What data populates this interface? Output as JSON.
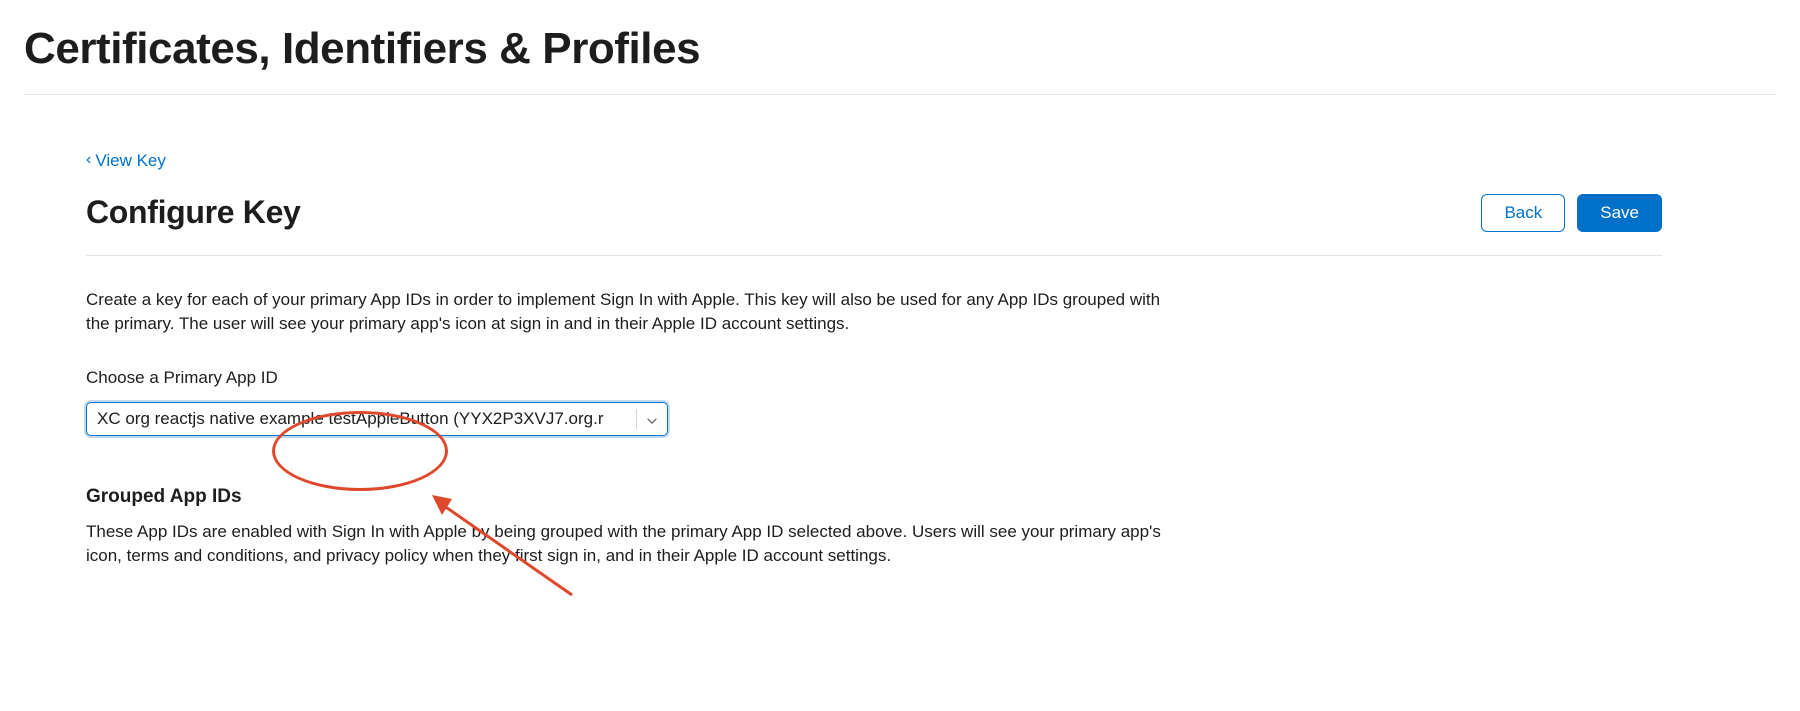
{
  "header": {
    "title": "Certificates, Identifiers & Profiles"
  },
  "nav": {
    "back_label": "View Key"
  },
  "section": {
    "title": "Configure Key",
    "back_button": "Back",
    "save_button": "Save"
  },
  "intro": "Create a key for each of your primary App IDs in order to implement Sign In with Apple. This key will also be used for any App IDs grouped with the primary. The user will see your primary app's icon at sign in and in their Apple ID account settings.",
  "primary_app_id": {
    "label": "Choose a Primary App ID",
    "selected": "XC org reactjs native example testAppleButton (YYX2P3XVJ7.org.r"
  },
  "grouped": {
    "heading": "Grouped App IDs",
    "text": "These App IDs are enabled with Sign In with Apple by being grouped with the primary App ID selected above. Users will see your primary app's icon, terms and conditions, and privacy policy when they first sign in, and in their Apple ID account settings."
  },
  "annotation": {
    "color": "#e0482b"
  }
}
